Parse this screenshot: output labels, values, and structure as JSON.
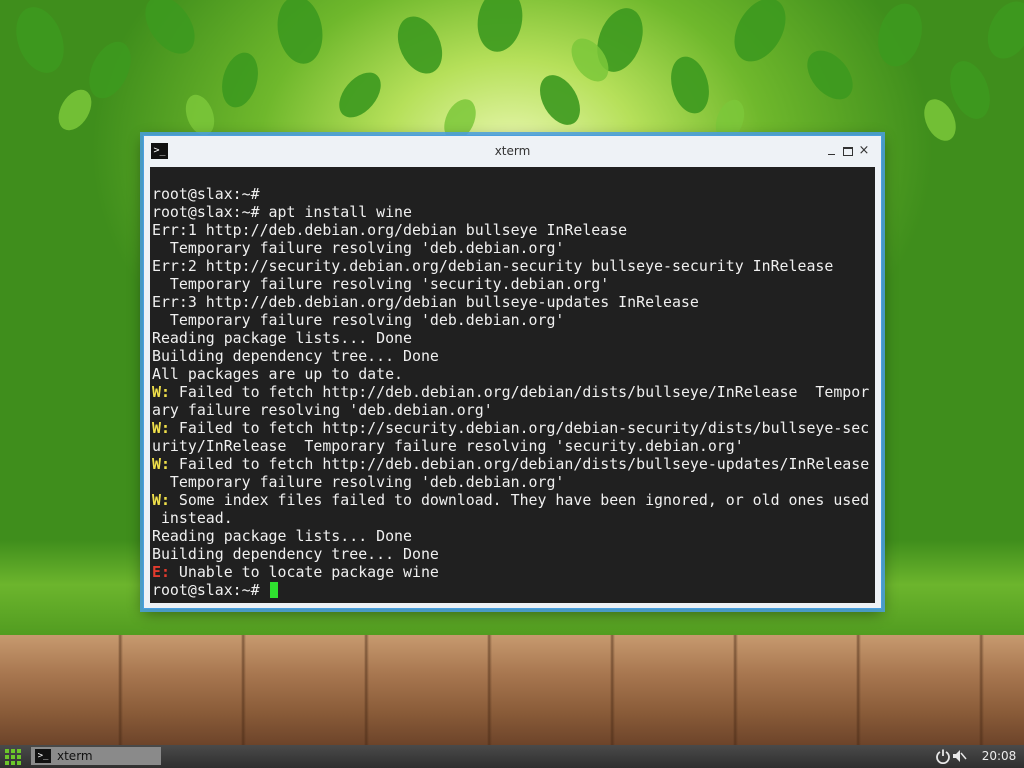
{
  "window": {
    "title": "xterm",
    "close_glyph": "×",
    "icon_glyph": ">_"
  },
  "terminal": {
    "lines": [
      "root@slax:~#",
      "root@slax:~# apt install wine",
      "Err:1 http://deb.debian.org/debian bullseye InRelease",
      "  Temporary failure resolving 'deb.debian.org'",
      "Err:2 http://security.debian.org/debian-security bullseye-security InRelease",
      "  Temporary failure resolving 'security.debian.org'",
      "Err:3 http://deb.debian.org/debian bullseye-updates InRelease",
      "  Temporary failure resolving 'deb.debian.org'",
      "Reading package lists... Done",
      "Building dependency tree... Done",
      "All packages are up to date.",
      "W: Failed to fetch http://deb.debian.org/debian/dists/bullseye/InRelease  Tempor",
      "ary failure resolving 'deb.debian.org'",
      "W: Failed to fetch http://security.debian.org/debian-security/dists/bullseye-sec",
      "urity/InRelease  Temporary failure resolving 'security.debian.org'",
      "W: Failed to fetch http://deb.debian.org/debian/dists/bullseye-updates/InRelease",
      "  Temporary failure resolving 'deb.debian.org'",
      "W: Some index files failed to download. They have been ignored, or old ones used",
      " instead.",
      "Reading package lists... Done",
      "Building dependency tree... Done",
      "E: Unable to locate package wine",
      "root@slax:~# "
    ],
    "colors": {
      "background": "#202020",
      "foreground": "#f0f0f0",
      "warning": "#f0e04a",
      "error": "#e23b2e",
      "cursor": "#2fe02f"
    }
  },
  "taskbar": {
    "task_label": "xterm",
    "task_icon_glyph": ">_",
    "clock": "20:08",
    "icons": [
      "start-menu-icon",
      "power-icon",
      "volume-muted-icon"
    ]
  }
}
